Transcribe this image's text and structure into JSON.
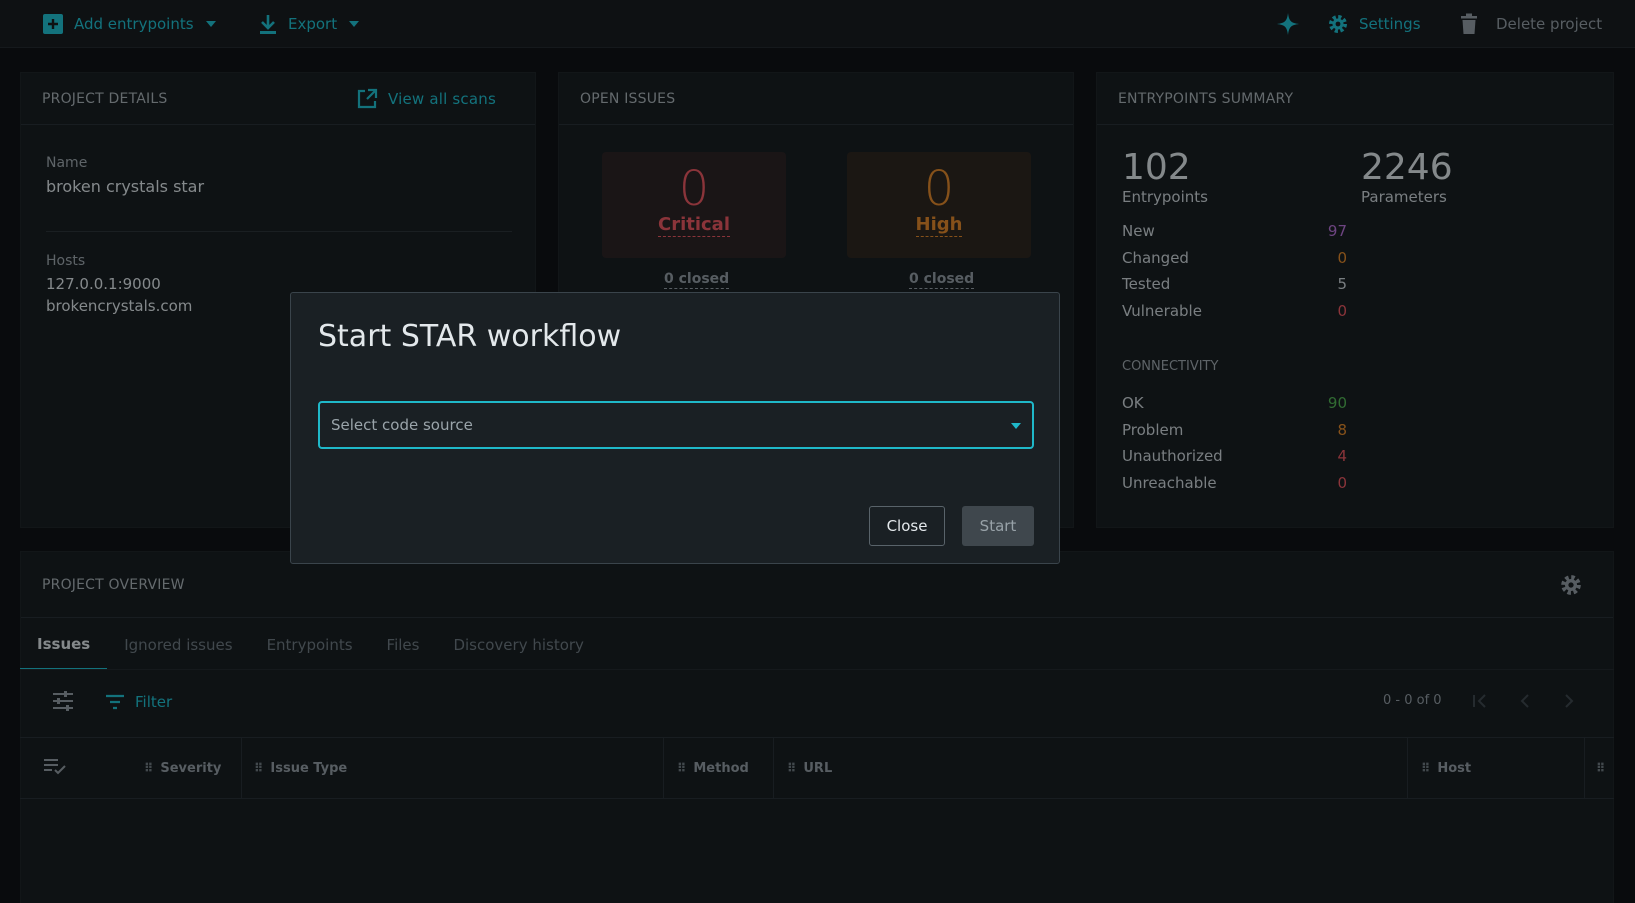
{
  "toolbar": {
    "add_entrypoints": "Add entrypoints",
    "export": "Export",
    "settings": "Settings",
    "delete_project": "Delete project"
  },
  "project_details": {
    "title": "PROJECT DETAILS",
    "view_all_scans": "View all scans",
    "name_label": "Name",
    "name_value": "broken crystals star",
    "hosts_label": "Hosts",
    "hosts": [
      "127.0.0.1:9000",
      "brokencrystals.com"
    ]
  },
  "open_issues": {
    "title": "OPEN ISSUES",
    "critical": {
      "count": "0",
      "label": "Critical",
      "closed": "0 closed"
    },
    "high": {
      "count": "0",
      "label": "High",
      "closed": "0 closed"
    }
  },
  "entrypoints_summary": {
    "title": "ENTRYPOINTS SUMMARY",
    "entrypoints_count": "102",
    "entrypoints_label": "Entrypoints",
    "parameters_count": "2246",
    "parameters_label": "Parameters",
    "status_rows": [
      {
        "label": "New",
        "value": "97",
        "color": "#b06fd0"
      },
      {
        "label": "Changed",
        "value": "0",
        "color": "#d9842a"
      },
      {
        "label": "Tested",
        "value": "5",
        "color": "#c4ccd1"
      },
      {
        "label": "Vulnerable",
        "value": "0",
        "color": "#e0555e"
      }
    ],
    "connectivity_title": "CONNECTIVITY",
    "connectivity_rows": [
      {
        "label": "OK",
        "value": "90",
        "color": "#4fae52"
      },
      {
        "label": "Problem",
        "value": "8",
        "color": "#d9842a"
      },
      {
        "label": "Unauthorized",
        "value": "4",
        "color": "#e0555e"
      },
      {
        "label": "Unreachable",
        "value": "0",
        "color": "#e0555e"
      }
    ]
  },
  "overview": {
    "title": "PROJECT OVERVIEW",
    "tabs": [
      "Issues",
      "Ignored issues",
      "Entrypoints",
      "Files",
      "Discovery history"
    ],
    "filter_label": "Filter",
    "pagination": "0 - 0 of 0",
    "columns": [
      "Severity",
      "Issue Type",
      "Method",
      "URL",
      "Host"
    ]
  },
  "modal": {
    "title": "Start STAR workflow",
    "select_placeholder": "Select code source",
    "close_label": "Close",
    "start_label": "Start"
  },
  "colors": {
    "accent": "#1fb8c9",
    "critical": "#e0555e",
    "high": "#d9842a"
  }
}
